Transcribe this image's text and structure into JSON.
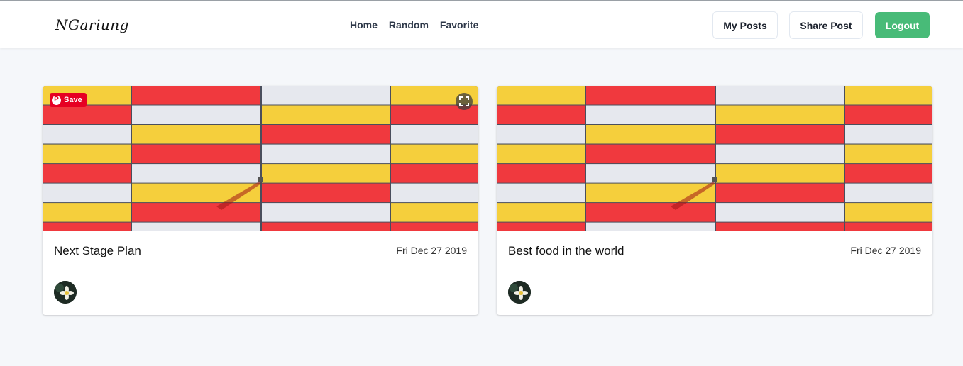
{
  "brand": {
    "name": "NGariung"
  },
  "nav": {
    "links": [
      {
        "label": "Home"
      },
      {
        "label": "Random"
      },
      {
        "label": "Favorite"
      }
    ]
  },
  "actions": {
    "my_posts": "My Posts",
    "share_post": "Share Post",
    "logout": "Logout"
  },
  "colors": {
    "accent": "#48bb78",
    "pinterest": "#e60023",
    "stripe_red": "#f0393e",
    "stripe_yellow": "#f5cf3c",
    "stripe_white": "#e6e8ee"
  },
  "posts": [
    {
      "title": "Next Stage Plan",
      "date": "Fri Dec 27 2019",
      "image_icon": "striped-panels-image",
      "avatar_icon": "flower-avatar",
      "overlay": {
        "save_label": "Save",
        "icons": [
          "pinterest-icon",
          "expand-icon"
        ]
      }
    },
    {
      "title": "Best food in the world",
      "date": "Fri Dec 27 2019",
      "image_icon": "striped-panels-image",
      "avatar_icon": "flower-avatar"
    }
  ]
}
